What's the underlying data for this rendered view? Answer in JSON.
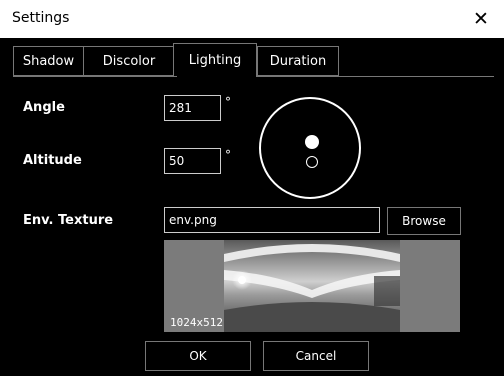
{
  "window": {
    "title": "Settings"
  },
  "tabs": [
    {
      "label": "Shadow",
      "active": false
    },
    {
      "label": "Discolor",
      "active": false
    },
    {
      "label": "Lighting",
      "active": true
    },
    {
      "label": "Duration",
      "active": false
    }
  ],
  "lighting": {
    "angle_label": "Angle",
    "angle_value": "281",
    "altitude_label": "Altitude",
    "altitude_value": "50",
    "degree_symbol": "°",
    "env_label": "Env. Texture",
    "env_value": "env.png",
    "browse_label": "Browse",
    "texture_resolution": "1024x512"
  },
  "footer": {
    "ok_label": "OK",
    "cancel_label": "Cancel"
  },
  "icons": {
    "close": "close-icon"
  },
  "colors": {
    "background": "#000000",
    "titlebar": "#ffffff",
    "preview_bg": "#7b7b7b"
  }
}
